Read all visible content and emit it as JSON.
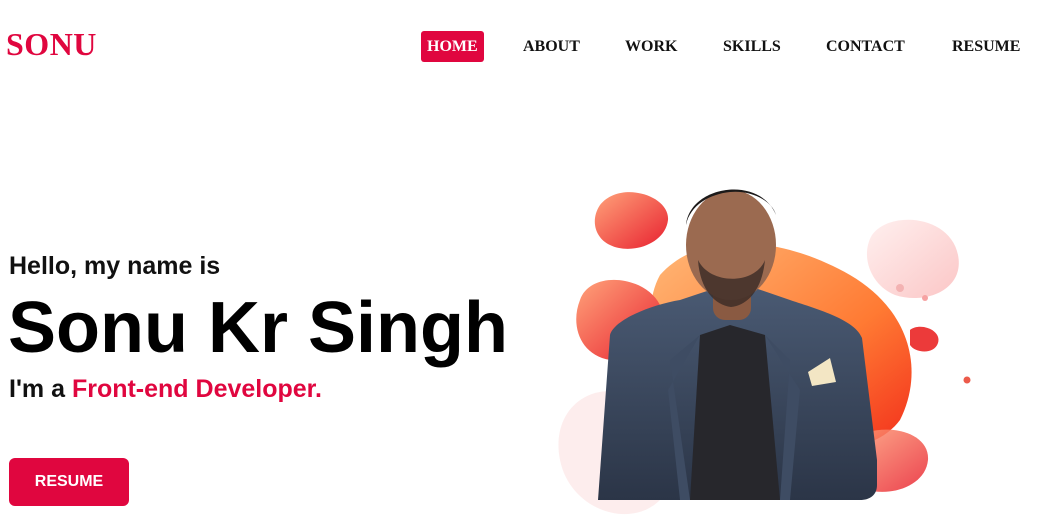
{
  "brand": {
    "logo": "SONU",
    "accent_color": "#e0063f"
  },
  "nav": {
    "items": [
      {
        "label": "HOME",
        "active": true
      },
      {
        "label": "ABOUT"
      },
      {
        "label": "WORK"
      },
      {
        "label": "SKILLS"
      },
      {
        "label": "CONTACT"
      },
      {
        "label": "RESUME"
      }
    ]
  },
  "hero": {
    "greeting": "Hello, my name is",
    "name": "Sonu Kr Singh",
    "role_prefix": "I'm a",
    "role_highlight": "Front-end Developer.",
    "cta_label": "RESUME"
  }
}
